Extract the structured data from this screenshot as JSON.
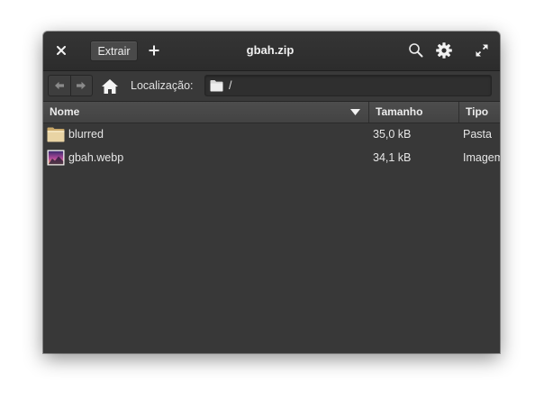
{
  "window": {
    "title": "gbah.zip",
    "extract_label": "Extrair"
  },
  "icons": {
    "close": "close-icon",
    "add": "plus-icon",
    "search": "search-icon",
    "settings": "gear-icon",
    "maximize": "maximize-icon",
    "back": "arrow-left-icon",
    "forward": "arrow-right-icon",
    "home": "home-icon",
    "location_folder": "folder-icon"
  },
  "location": {
    "label": "Localização:",
    "path": "/"
  },
  "columns": {
    "name": "Nome",
    "size": "Tamanho",
    "type": "Tipo"
  },
  "files": [
    {
      "name": "blurred",
      "size": "35,0 kB",
      "type": "Pasta",
      "icon": "folder-icon"
    },
    {
      "name": "gbah.webp",
      "size": "34,1 kB",
      "type": "Imagem",
      "icon": "image-thumbnail-icon"
    }
  ],
  "colors": {
    "window_bg": "#383838",
    "header_bg": "#4a4a4a",
    "text": "#e6e6e6"
  }
}
